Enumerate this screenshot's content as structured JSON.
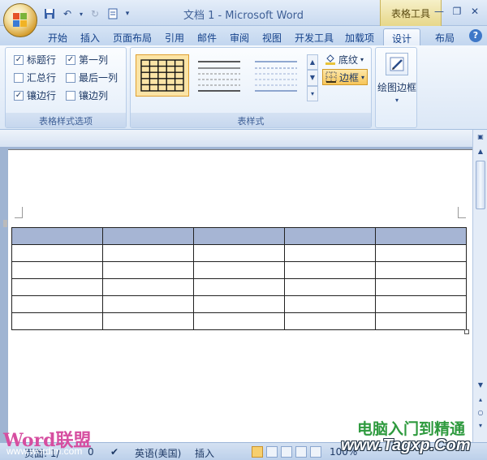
{
  "window": {
    "title": "文档 1 - Microsoft Word",
    "contextual_tab_group": "表格工具"
  },
  "quick_access": {
    "save_icon": "save-icon",
    "undo_icon": "undo-icon",
    "redo_icon": "redo-icon",
    "print_preview_icon": "document-icon"
  },
  "tabs": [
    {
      "label": "开始"
    },
    {
      "label": "插入"
    },
    {
      "label": "页面布局"
    },
    {
      "label": "引用"
    },
    {
      "label": "邮件"
    },
    {
      "label": "审阅"
    },
    {
      "label": "视图"
    },
    {
      "label": "开发工具"
    },
    {
      "label": "加载项"
    },
    {
      "label": "设计",
      "active": true
    },
    {
      "label": "布局"
    }
  ],
  "ribbon": {
    "table_style_options": {
      "label": "表格样式选项",
      "options": [
        {
          "label": "标题行",
          "checked": true
        },
        {
          "label": "第一列",
          "checked": true
        },
        {
          "label": "汇总行",
          "checked": false
        },
        {
          "label": "最后一列",
          "checked": false
        },
        {
          "label": "镶边行",
          "checked": true
        },
        {
          "label": "镶边列",
          "checked": false
        }
      ]
    },
    "table_styles": {
      "label": "表样式",
      "shading_label": "底纹",
      "borders_label": "边框"
    },
    "draw_borders": {
      "label": "绘图边框"
    }
  },
  "status_bar": {
    "page_partial": "页面: 1/",
    "word_count_partial": "0",
    "language": "英语(美国)",
    "insert_mode": "插入",
    "zoom": "100%"
  },
  "watermarks": {
    "left_logo": "Word联盟",
    "left_url": "www.wordlm.com",
    "right_title": "电脑入门到精通",
    "right_url": "www.Tagxp.Com"
  },
  "colors": {
    "ribbon_bg": "#dbe7f6",
    "table_header_fill": "#a6b5d4",
    "contextual_tab": "#e7d78a",
    "highlight": "#f7c65a"
  }
}
